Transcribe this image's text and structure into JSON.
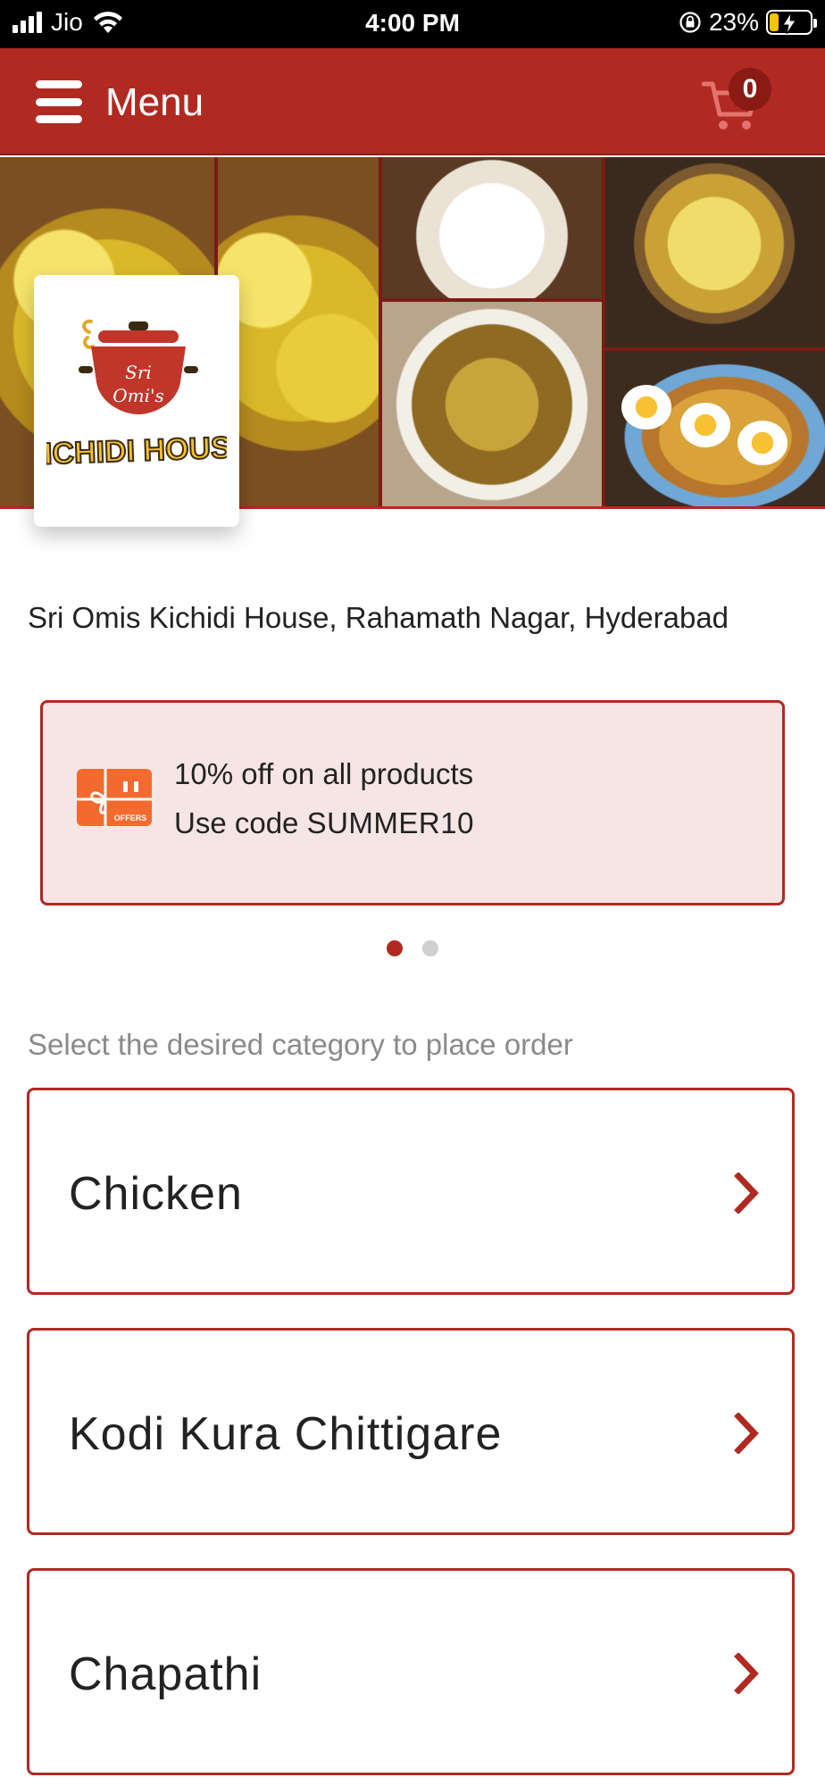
{
  "status_bar": {
    "carrier": "Jio",
    "time": "4:00 PM",
    "battery_percent": "23%",
    "battery_level": 0.23,
    "signal_bars": 3
  },
  "header": {
    "title": "Menu",
    "cart_count": "0",
    "menu_icon": "hamburger-icon",
    "cart_icon": "shopping-cart-icon"
  },
  "brand": {
    "logo_lines": [
      "Sri",
      "Omi's",
      "KICHIDI HOUSE"
    ],
    "logo_colors": {
      "pot": "#c1362a",
      "text": "#f2c12e",
      "outline": "#3b2a12"
    }
  },
  "restaurant": {
    "address": "Sri Omis Kichidi House, Rahamath Nagar, Hyderabad"
  },
  "offer": {
    "icon": "offers-gift-icon",
    "line1": "10% off on all products",
    "line2_prefix": "Use code ",
    "code": "SUMMER10",
    "icon_label": "OFFERS"
  },
  "carousel": {
    "total": 2,
    "active_index": 0
  },
  "category_hint": "Select the desired category to place order",
  "categories": [
    {
      "label": "Chicken"
    },
    {
      "label": "Kodi Kura Chittigare"
    },
    {
      "label": "Chapathi"
    }
  ],
  "colors": {
    "primary": "#b02a22",
    "offer_bg": "#f6e5e5",
    "hint_text": "#8a8a8a"
  }
}
